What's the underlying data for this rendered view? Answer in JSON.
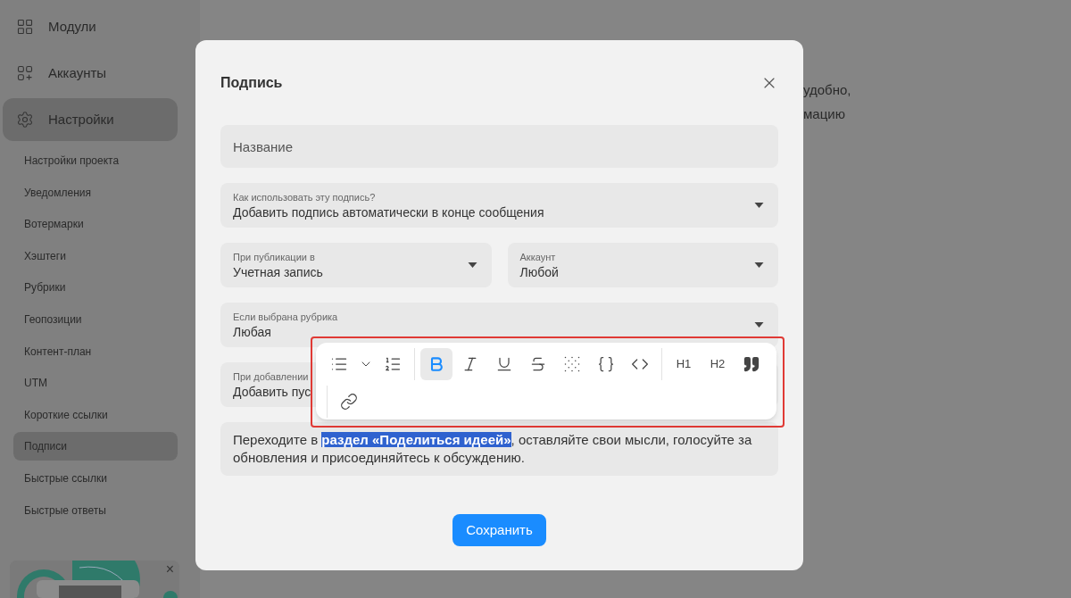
{
  "sidebar": {
    "items": [
      {
        "label": "Модули",
        "selected": false
      },
      {
        "label": "Аккаунты",
        "selected": false
      },
      {
        "label": "Настройки",
        "selected": true
      }
    ],
    "subitems": [
      {
        "label": "Настройки проекта",
        "selected": false
      },
      {
        "label": "Уведомления",
        "selected": false
      },
      {
        "label": "Вотермарки",
        "selected": false
      },
      {
        "label": "Хэштеги",
        "selected": false
      },
      {
        "label": "Рубрики",
        "selected": false
      },
      {
        "label": "Геопозиции",
        "selected": false
      },
      {
        "label": "Контент-план",
        "selected": false
      },
      {
        "label": "UTM",
        "selected": false
      },
      {
        "label": "Короткие ссылки",
        "selected": false
      },
      {
        "label": "Подписи",
        "selected": true
      },
      {
        "label": "Быстрые ссылки",
        "selected": false
      },
      {
        "label": "Быстрые ответы",
        "selected": false
      }
    ],
    "promo": {
      "kind": "picture",
      "close": "×"
    }
  },
  "background_text": [
    "удобно,",
    "мацию"
  ],
  "dialog": {
    "title": "Подпись",
    "name_field": {
      "placeholder": "Название"
    },
    "selects": [
      {
        "label": "Как использовать эту подпись?",
        "value": "Добавить подпись автоматически в конце сообщения"
      },
      {
        "label": "При публикации в",
        "value": "Учетная запись"
      },
      {
        "label": "Аккаунт",
        "value": "Любой"
      },
      {
        "label": "Если выбрана рубрика",
        "value": "Любая"
      },
      {
        "label": "При добавлении",
        "value": "Добавить пус"
      }
    ],
    "editor_text": "Переходите в **раздел «Поделиться идеей»**, оставляйте свои мысли, голосуйте за обновления и присоединяйтесь к обсуждению.",
    "toolbar": {
      "highlighted": true,
      "items": [
        {
          "kind": "bullet-list",
          "selected": false
        },
        {
          "kind": "caret",
          "selected": false
        },
        {
          "kind": "ordered-list",
          "selected": false
        },
        {
          "kind": "divider"
        },
        {
          "kind": "bold",
          "selected": true
        },
        {
          "kind": "italic",
          "selected": false
        },
        {
          "kind": "underline",
          "selected": false
        },
        {
          "kind": "strike",
          "selected": false
        },
        {
          "kind": "spoiler",
          "selected": false
        },
        {
          "kind": "variable",
          "selected": false
        },
        {
          "kind": "code",
          "selected": false
        },
        {
          "kind": "divider"
        },
        {
          "kind": "text",
          "label": "H1",
          "selected": false
        },
        {
          "kind": "text",
          "label": "H2",
          "selected": false
        },
        {
          "kind": "quote",
          "selected": false
        },
        {
          "kind": "divider"
        },
        {
          "kind": "link",
          "selected": false
        }
      ]
    },
    "save_button": "Сохранить"
  }
}
